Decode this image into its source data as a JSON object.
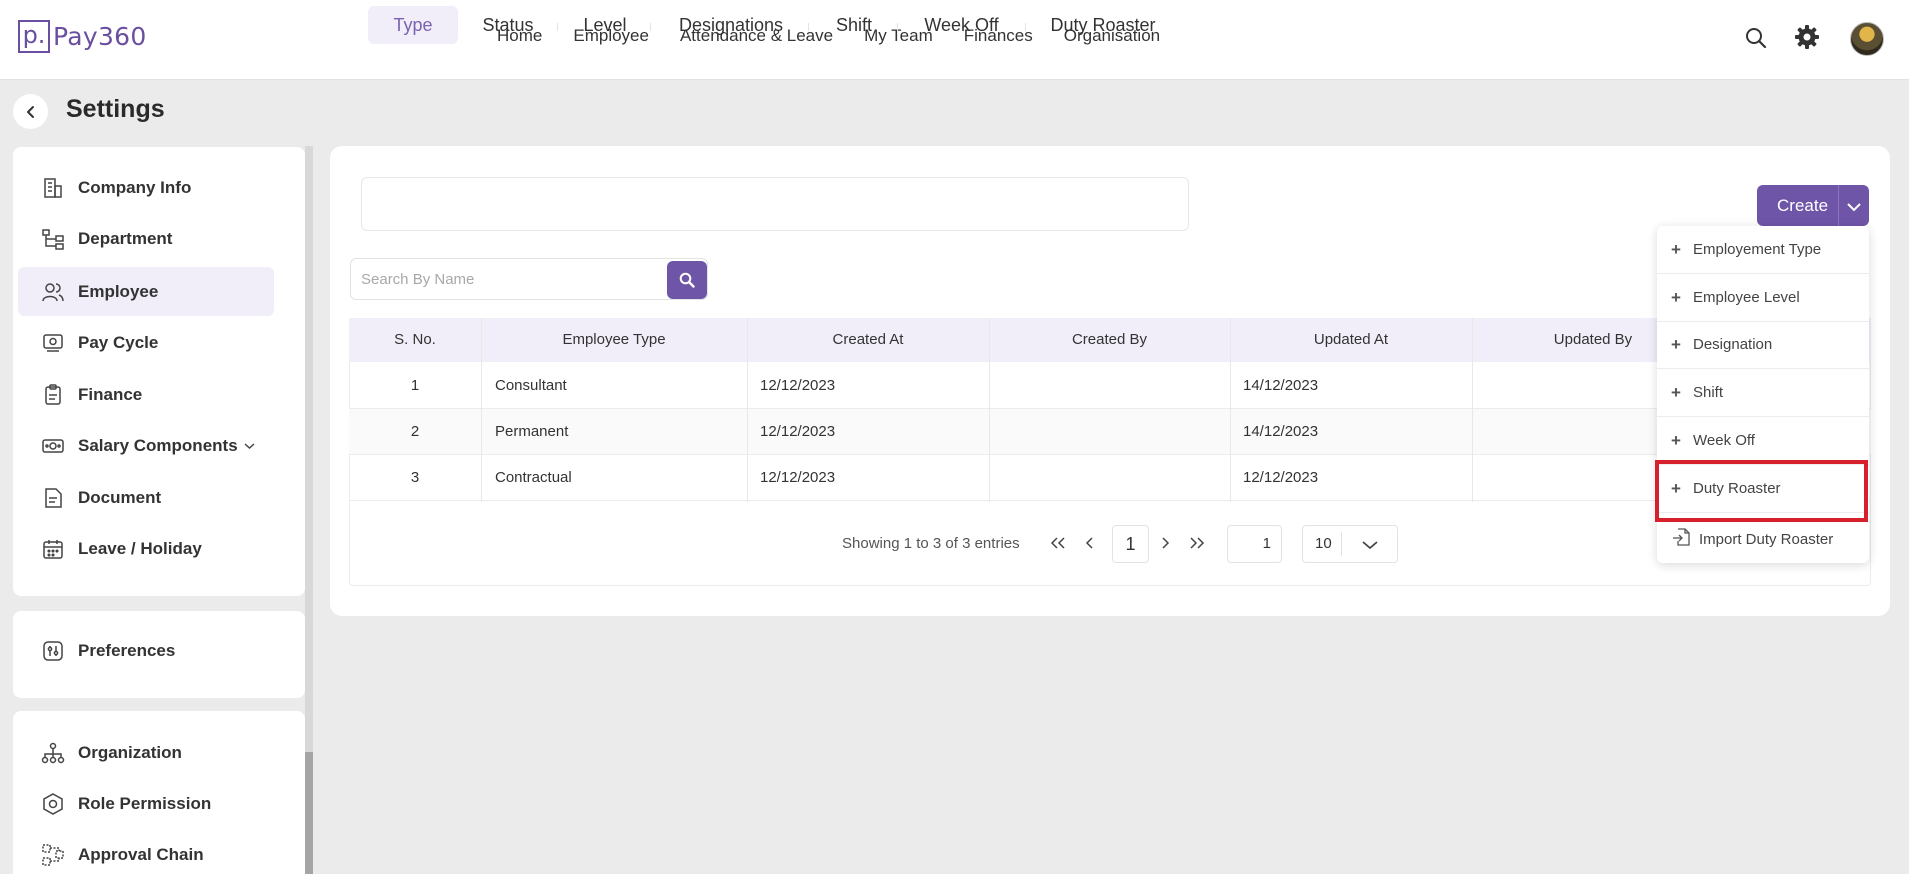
{
  "app": {
    "logo_mark": "p.",
    "logo_name": "Pay360"
  },
  "nav": [
    "Home",
    "Employee",
    "Attendance & Leave",
    "My Team",
    "Finances",
    "Organisation"
  ],
  "page": {
    "title": "Settings"
  },
  "sidebar": {
    "items": [
      {
        "label": "Company Info",
        "icon": "building-icon"
      },
      {
        "label": "Department",
        "icon": "org-tree-icon"
      },
      {
        "label": "Employee",
        "icon": "users-icon",
        "active": true
      },
      {
        "label": "Pay Cycle",
        "icon": "pay-cycle-icon"
      },
      {
        "label": "Finance",
        "icon": "clipboard-icon"
      },
      {
        "label": "Salary Components",
        "icon": "money-icon",
        "has_submenu": true
      },
      {
        "label": "Document",
        "icon": "document-icon"
      },
      {
        "label": "Leave / Holiday",
        "icon": "calendar-icon"
      }
    ],
    "preferences": {
      "label": "Preferences",
      "icon": "preferences-icon"
    },
    "admin_items": [
      {
        "label": "Organization",
        "icon": "hierarchy-icon"
      },
      {
        "label": "Role Permission",
        "icon": "hexagon-icon"
      },
      {
        "label": "Approval Chain",
        "icon": "approval-chain-icon"
      }
    ]
  },
  "tabs": [
    "Type",
    "Status",
    "Level",
    "Designations",
    "Shift",
    "Week Off",
    "Duty Roaster"
  ],
  "active_tab": "Type",
  "search": {
    "placeholder": "Search By Name",
    "value": ""
  },
  "table": {
    "columns": [
      "S. No.",
      "Employee Type",
      "Created At",
      "Created By",
      "Updated At",
      "Updated By"
    ],
    "rows": [
      [
        "1",
        "Consultant",
        "12/12/2023",
        "",
        "14/12/2023",
        ""
      ],
      [
        "2",
        "Permanent",
        "12/12/2023",
        "",
        "14/12/2023",
        ""
      ],
      [
        "3",
        "Contractual",
        "12/12/2023",
        "",
        "12/12/2023",
        ""
      ]
    ]
  },
  "pagination": {
    "summary": "Showing 1 to 3 of 3 entries",
    "current_page": "1",
    "jump_page": "1",
    "page_size": "10"
  },
  "create": {
    "label": "Create",
    "menu": [
      {
        "label": "Employement Type",
        "icon": "plus-icon"
      },
      {
        "label": "Employee Level",
        "icon": "plus-icon"
      },
      {
        "label": "Designation",
        "icon": "plus-icon"
      },
      {
        "label": "Shift",
        "icon": "plus-icon"
      },
      {
        "label": "Week Off",
        "icon": "plus-icon"
      },
      {
        "label": "Duty Roaster",
        "icon": "plus-icon",
        "highlighted": true
      },
      {
        "label": "Import Duty Roaster",
        "icon": "import-file-icon"
      }
    ]
  },
  "colors": {
    "brand": "#6e55a8",
    "active_bg": "#f1eef9",
    "highlight_border": "#d6202b",
    "page_bg": "#ebebeb"
  }
}
